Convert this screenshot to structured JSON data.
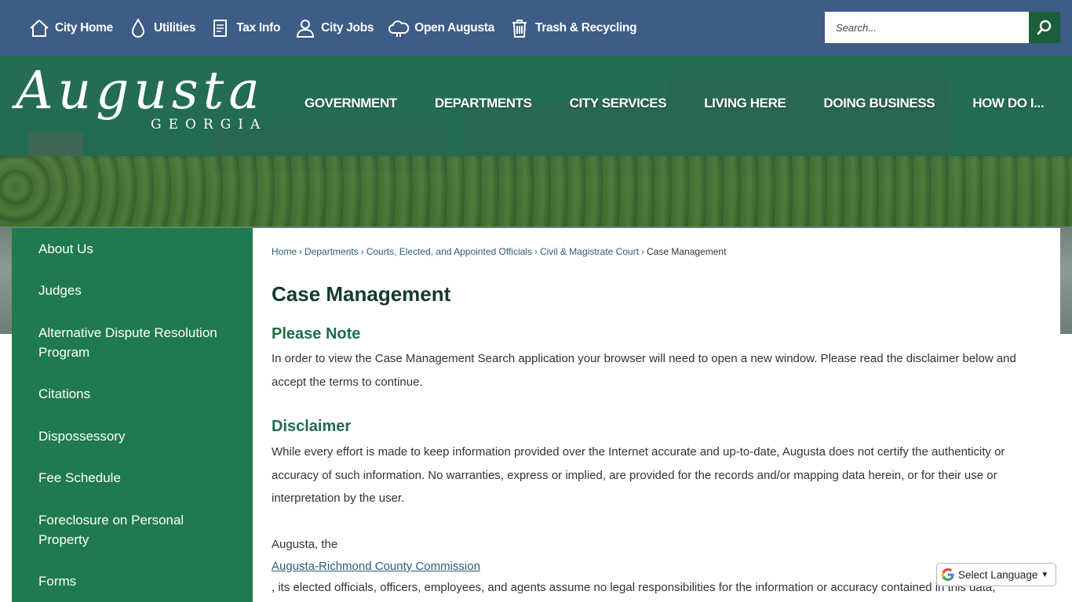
{
  "quick_links": [
    {
      "label": "City Home",
      "icon": "home-icon"
    },
    {
      "label": "Utilities",
      "icon": "water-drop-icon"
    },
    {
      "label": "Tax Info",
      "icon": "document-icon"
    },
    {
      "label": "City Jobs",
      "icon": "person-icon"
    },
    {
      "label": "Open Augusta",
      "icon": "cloud-icon"
    },
    {
      "label": "Trash & Recycling",
      "icon": "trash-icon"
    }
  ],
  "search": {
    "placeholder": "Search..."
  },
  "logo": {
    "script": "Augusta",
    "state": "GEORGIA"
  },
  "main_nav": [
    "GOVERNMENT",
    "DEPARTMENTS",
    "CITY SERVICES",
    "LIVING HERE",
    "DOING BUSINESS",
    "HOW DO I..."
  ],
  "sidebar": [
    "About Us",
    "Judges",
    "Alternative Dispute Resolution Program",
    "Citations",
    "Dispossessory",
    "Fee Schedule",
    "Foreclosure on Personal Property",
    "Forms"
  ],
  "breadcrumb": {
    "links": [
      "Home",
      "Departments",
      "Courts, Elected, and Appointed Officials",
      "Civil & Magistrate Court"
    ],
    "current": "Case Management",
    "separator": "›"
  },
  "page": {
    "title": "Case Management",
    "please_note_heading": "Please Note",
    "please_note_text": "In order to view the Case Management Search application your browser will need to open a new window. Please read the disclaimer below and accept the terms to continue.",
    "disclaimer_heading": "Disclaimer",
    "disclaimer_text": "While every effort is made to keep information provided over the Internet accurate and up-to-date, Augusta does not certify the authenticity or accuracy of such information. No warranties, express or implied, are provided for the records and/or mapping data herein, or for their use or interpretation by the user.",
    "augusta_prefix": "Augusta, the",
    "commission_link": "Augusta-Richmond County Commission",
    "responsibility_text": ", its elected officials, officers, employees, and agents assume no legal responsibilities for the information or accuracy contained in this data,"
  },
  "translate": {
    "label": "Select Language"
  },
  "colors": {
    "topbar": "#3d5c86",
    "sidebar": "#1f7a4d",
    "heading": "#1f6e48",
    "link": "#2c5d74"
  }
}
